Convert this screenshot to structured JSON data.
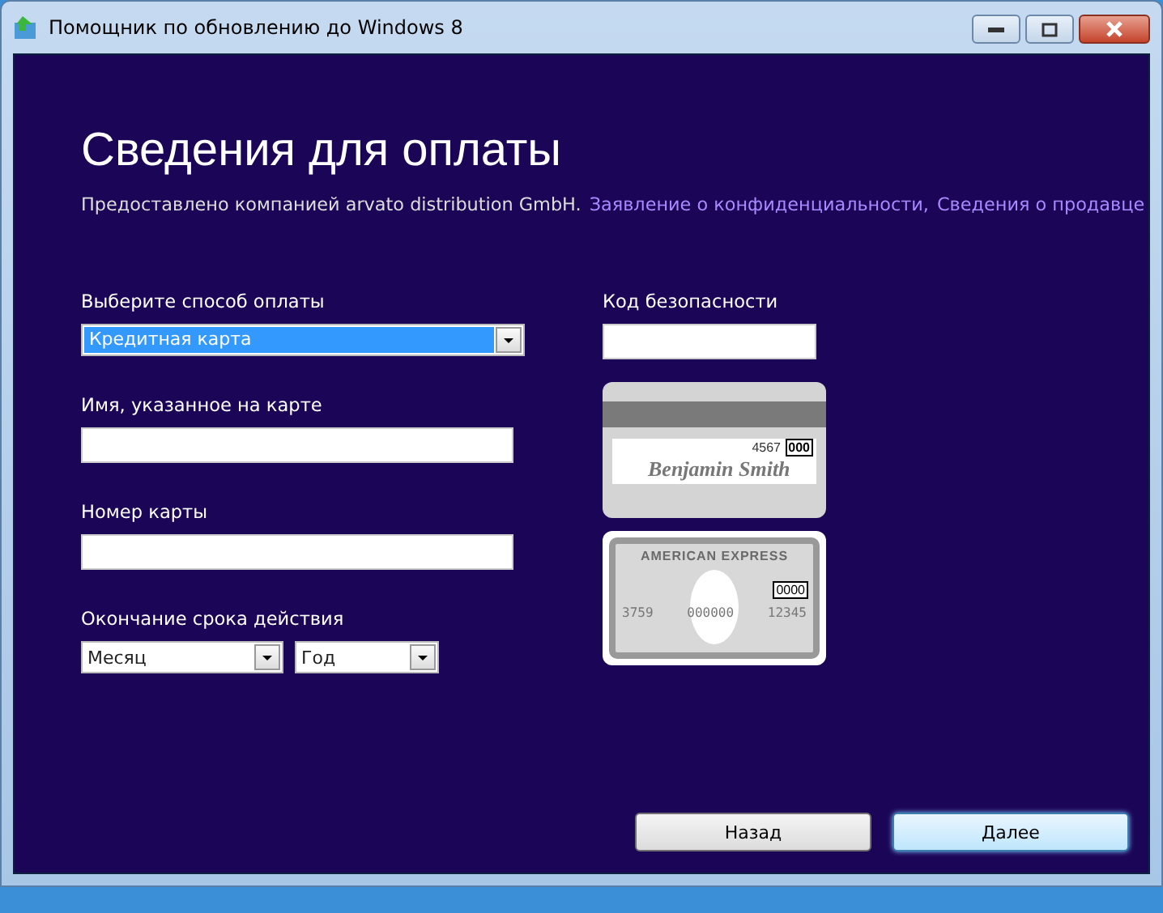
{
  "window": {
    "title": "Помощник по обновлению до Windows 8"
  },
  "heading": "Сведения для оплаты",
  "provider": {
    "text": "Предоставлено компанией arvato distribution GmbH.",
    "links": [
      "Заявление о конфиденциальности,",
      "Сведения о продавце"
    ]
  },
  "form": {
    "payment_method": {
      "label": "Выберите способ оплаты",
      "value": "Кредитная карта",
      "focused": true
    },
    "card_name": {
      "label": "Имя, указанное на карте"
    },
    "card_number": {
      "label": "Номер карты"
    },
    "expiry": {
      "label": "Окончание срока действия",
      "month": "Месяц",
      "year": "Год"
    },
    "security_code": {
      "label": "Код безопасности"
    }
  },
  "card_samples": [
    {
      "kind": "back",
      "number": "4567",
      "code": "000",
      "name": "Benjamin Smith"
    },
    {
      "kind": "amex",
      "brand": "AMERICAN EXPRESS",
      "code": "0000",
      "numbers": [
        "3759",
        "000000",
        "12345"
      ]
    }
  ],
  "buttons": [
    {
      "label": "Назад",
      "default": false
    },
    {
      "label": "Далее",
      "default": true
    }
  ]
}
